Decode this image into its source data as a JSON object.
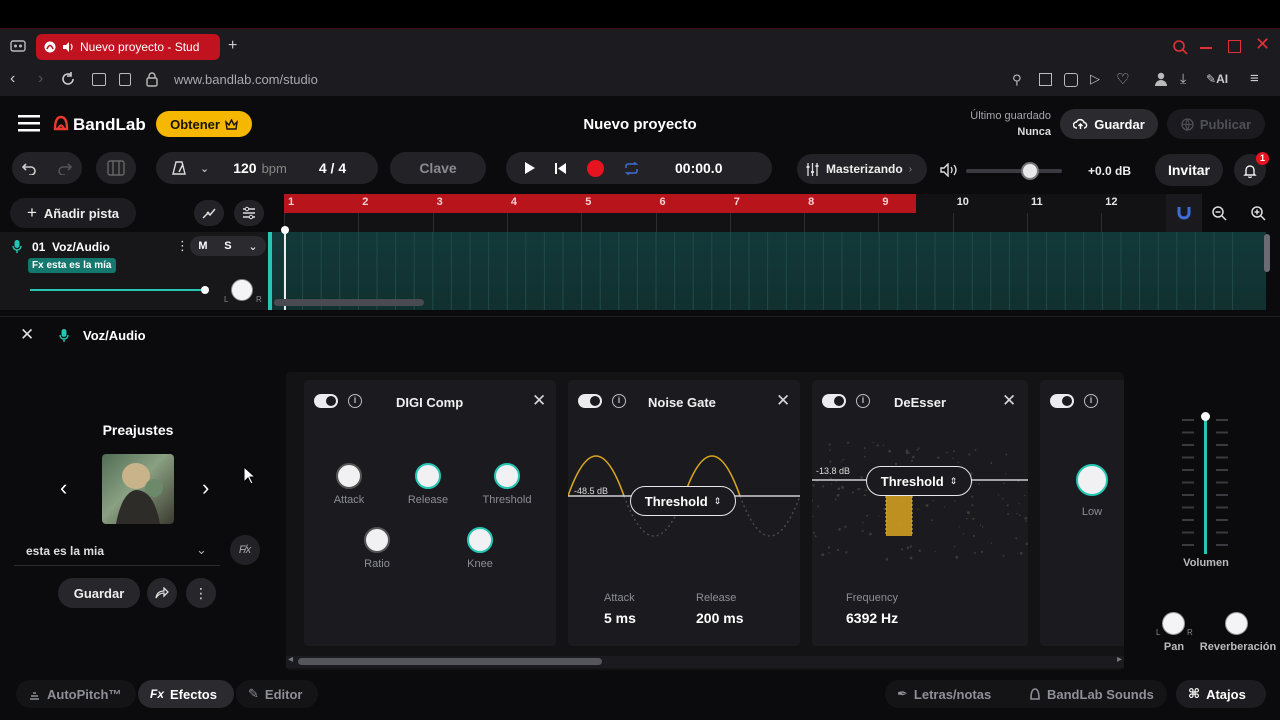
{
  "browser": {
    "tab_title": "Nuevo proyecto - Stud",
    "url": "www.bandlab.com/studio",
    "ai_label": "AI"
  },
  "header": {
    "brand": "BandLab",
    "get_button": "Obtener",
    "project_title": "Nuevo proyecto",
    "last_saved_label": "Último guardado",
    "last_saved_value": "Nunca",
    "save_button": "Guardar",
    "publish_button": "Publicar"
  },
  "transport": {
    "bpm_value": "120",
    "bpm_unit": "bpm",
    "time_signature": "4 / 4",
    "key_button": "Clave",
    "time_display": "00:00.0",
    "mastering_label": "Masterizando",
    "master_gain": "+0.0 dB",
    "invite_button": "Invitar",
    "notification_count": "1"
  },
  "timeline": {
    "add_track_button": "Añadir pista",
    "ruler": [
      "1",
      "2",
      "3",
      "4",
      "5",
      "6",
      "7",
      "8",
      "9",
      "10",
      "11",
      "12"
    ]
  },
  "track": {
    "name": "01  Voz/Audio",
    "mute": "M",
    "solo": "S",
    "fx_chip": "Fx esta es la mía",
    "pan_left": "L",
    "pan_right": "R"
  },
  "fx_bar": {
    "track_label": "Voz/Audio"
  },
  "presets": {
    "title": "Preajustes",
    "selected": "esta es la mia",
    "save_button": "Guardar"
  },
  "effects": {
    "digi_comp": {
      "title": "DIGI Comp",
      "knobs": [
        "Attack",
        "Release",
        "Threshold",
        "Ratio",
        "Knee"
      ]
    },
    "noise_gate": {
      "title": "Noise Gate",
      "level": "-48.5 dB",
      "threshold": "Threshold",
      "attack_label": "Attack",
      "attack_value": "5 ms",
      "release_label": "Release",
      "release_value": "200 ms"
    },
    "deesser": {
      "title": "DeEsser",
      "level": "-13.8 dB",
      "threshold": "Threshold",
      "frequency_label": "Frequency",
      "frequency_value": "6392 Hz"
    },
    "fourth": {
      "knob_label": "Low"
    }
  },
  "mixer": {
    "volume_label": "Volumen",
    "pan_label": "Pan",
    "reverb_label": "Reverberación",
    "pan_left": "L",
    "pan_right": "R"
  },
  "bottom": {
    "autopitch": "AutoPitch™",
    "effects_prefix": "Fx",
    "effects": "Efectos",
    "editor": "Editor",
    "lyrics": "Letras/notas",
    "sounds": "BandLab Sounds",
    "shortcuts": "Atajos"
  },
  "colors": {
    "accent_teal": "#26c6b4",
    "record_red": "#e5141f",
    "brand_orange": "#f5b700",
    "ruler_red": "#b8141c",
    "wave_gold": "#d9a521"
  }
}
